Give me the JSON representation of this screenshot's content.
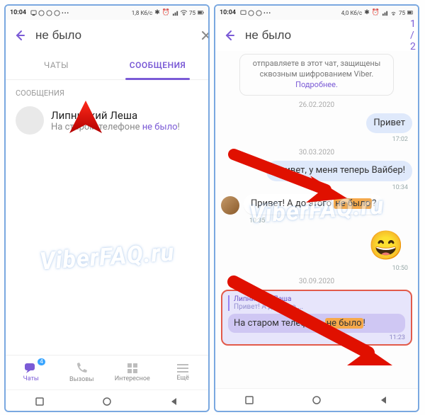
{
  "status": {
    "time": "10:04",
    "net_left": "1,8 Кб/с",
    "net_right": "4,0 Кб/с",
    "batt": "75"
  },
  "left": {
    "search_value": "не было",
    "tabs": {
      "chats": "ЧАТЫ",
      "messages": "СООБЩЕНИЯ"
    },
    "section": "СООБЩЕНИЯ",
    "result": {
      "name": "Липницкий Леша",
      "snippet_pre": "На старом телефоне ",
      "snippet_hl": "не было",
      "snippet_post": "!"
    },
    "bottom": {
      "chats": "Чаты",
      "chats_badge": "4",
      "calls": "Вызовы",
      "interesting": "Интересное",
      "more": "Ещё"
    }
  },
  "right": {
    "search_value": "не было",
    "counter": "1 / 2",
    "enc_line1": "отправляете в этот чат, защищены",
    "enc_line2": "сквозным шифрованием Viber.",
    "enc_more": "Подробнее.",
    "d1": "26.02.2020",
    "m1": {
      "text": "Привет",
      "time": "17:02"
    },
    "d2": "30.03.2020",
    "m2": {
      "text": "Привет, у меня теперь Вайбер!",
      "time": "10:34"
    },
    "m3": {
      "pre": "Привет! А до этого ",
      "hl": "не было",
      "post": "?",
      "time": "10:35"
    },
    "m4": {
      "time": "10:50"
    },
    "d3": "30.09.2020",
    "reply": {
      "cite_name": "Липницкий Леша",
      "cite_text": "Привет! А до этого ...",
      "pre": "На старом телефоне ",
      "hl": "не было",
      "post": "!",
      "time": "11:23"
    }
  },
  "watermark": "ViberFAQ.ru"
}
